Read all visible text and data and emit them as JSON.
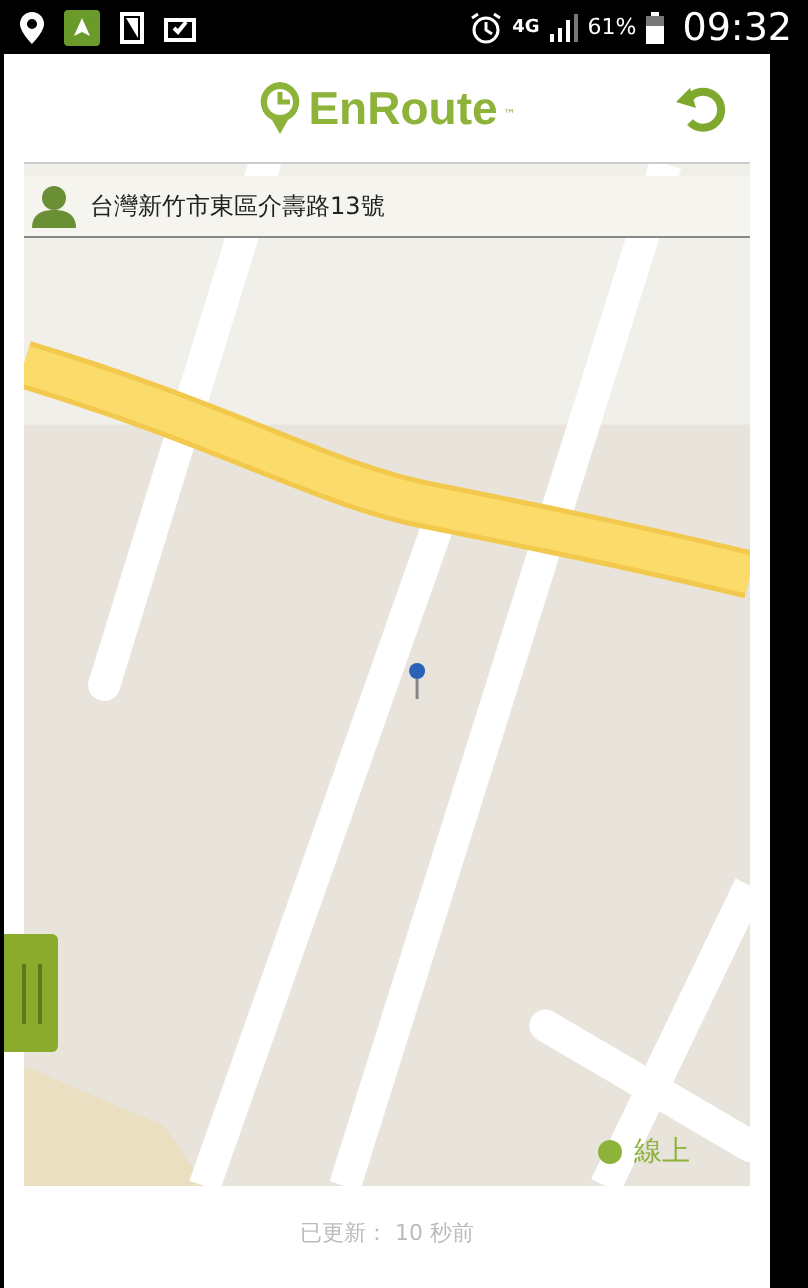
{
  "status_bar": {
    "network": "4G",
    "battery": "61%",
    "time": "09:32"
  },
  "header": {
    "logo": "EnRoute",
    "trademark": "™"
  },
  "address_bar": {
    "address": "台灣新竹市東區介壽路13號"
  },
  "connection": {
    "label": "線上",
    "online": true
  },
  "updated": "已更新： 10 秒前"
}
